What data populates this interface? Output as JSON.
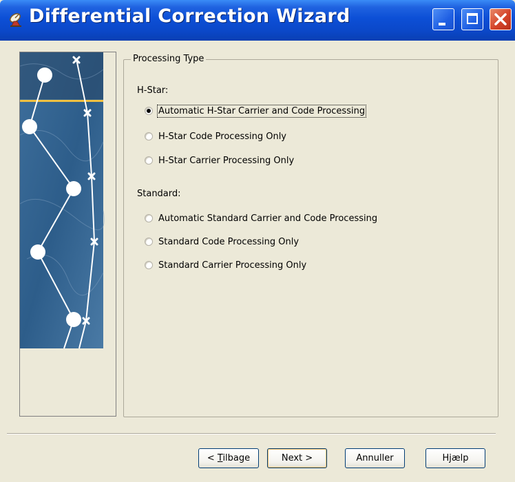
{
  "window": {
    "title": "Differential Correction Wizard",
    "app_icon": "satellite-dish-icon",
    "controls": [
      "minimize-icon",
      "maximize-icon",
      "close-icon"
    ]
  },
  "group": {
    "legend": "Processing Type"
  },
  "hstar": {
    "label": "H-Star:",
    "options": [
      {
        "label": "Automatic H-Star Carrier and Code Processing",
        "selected": true
      },
      {
        "label": "H-Star Code Processing Only",
        "selected": false
      },
      {
        "label": "H-Star Carrier Processing Only",
        "selected": false
      }
    ]
  },
  "standard": {
    "label": "Standard:",
    "options": [
      {
        "label": "Automatic Standard Carrier and Code Processing",
        "selected": false
      },
      {
        "label": "Standard Code Processing Only",
        "selected": false
      },
      {
        "label": "Standard Carrier Processing Only",
        "selected": false
      }
    ]
  },
  "buttons": {
    "back_prefix": "< ",
    "back_mnemonic": "T",
    "back_rest": "ilbage",
    "next": "Next >",
    "cancel": "Annuller",
    "help": "Hjælp"
  },
  "colors": {
    "titlebar": "#0c4fd6",
    "dialog_bg": "#ece9d8",
    "close_button": "#d5452a"
  }
}
